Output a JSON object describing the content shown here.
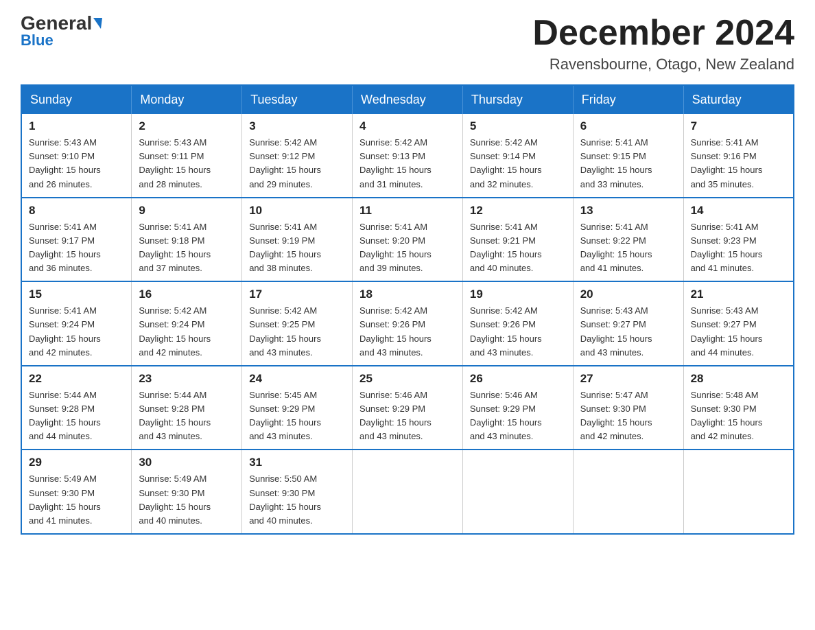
{
  "logo": {
    "name_part1": "General",
    "name_part2": "Blue"
  },
  "header": {
    "title": "December 2024",
    "location": "Ravensbourne, Otago, New Zealand"
  },
  "days_of_week": [
    "Sunday",
    "Monday",
    "Tuesday",
    "Wednesday",
    "Thursday",
    "Friday",
    "Saturday"
  ],
  "weeks": [
    [
      {
        "day": "1",
        "sunrise": "5:43 AM",
        "sunset": "9:10 PM",
        "daylight": "15 hours and 26 minutes."
      },
      {
        "day": "2",
        "sunrise": "5:43 AM",
        "sunset": "9:11 PM",
        "daylight": "15 hours and 28 minutes."
      },
      {
        "day": "3",
        "sunrise": "5:42 AM",
        "sunset": "9:12 PM",
        "daylight": "15 hours and 29 minutes."
      },
      {
        "day": "4",
        "sunrise": "5:42 AM",
        "sunset": "9:13 PM",
        "daylight": "15 hours and 31 minutes."
      },
      {
        "day": "5",
        "sunrise": "5:42 AM",
        "sunset": "9:14 PM",
        "daylight": "15 hours and 32 minutes."
      },
      {
        "day": "6",
        "sunrise": "5:41 AM",
        "sunset": "9:15 PM",
        "daylight": "15 hours and 33 minutes."
      },
      {
        "day": "7",
        "sunrise": "5:41 AM",
        "sunset": "9:16 PM",
        "daylight": "15 hours and 35 minutes."
      }
    ],
    [
      {
        "day": "8",
        "sunrise": "5:41 AM",
        "sunset": "9:17 PM",
        "daylight": "15 hours and 36 minutes."
      },
      {
        "day": "9",
        "sunrise": "5:41 AM",
        "sunset": "9:18 PM",
        "daylight": "15 hours and 37 minutes."
      },
      {
        "day": "10",
        "sunrise": "5:41 AM",
        "sunset": "9:19 PM",
        "daylight": "15 hours and 38 minutes."
      },
      {
        "day": "11",
        "sunrise": "5:41 AM",
        "sunset": "9:20 PM",
        "daylight": "15 hours and 39 minutes."
      },
      {
        "day": "12",
        "sunrise": "5:41 AM",
        "sunset": "9:21 PM",
        "daylight": "15 hours and 40 minutes."
      },
      {
        "day": "13",
        "sunrise": "5:41 AM",
        "sunset": "9:22 PM",
        "daylight": "15 hours and 41 minutes."
      },
      {
        "day": "14",
        "sunrise": "5:41 AM",
        "sunset": "9:23 PM",
        "daylight": "15 hours and 41 minutes."
      }
    ],
    [
      {
        "day": "15",
        "sunrise": "5:41 AM",
        "sunset": "9:24 PM",
        "daylight": "15 hours and 42 minutes."
      },
      {
        "day": "16",
        "sunrise": "5:42 AM",
        "sunset": "9:24 PM",
        "daylight": "15 hours and 42 minutes."
      },
      {
        "day": "17",
        "sunrise": "5:42 AM",
        "sunset": "9:25 PM",
        "daylight": "15 hours and 43 minutes."
      },
      {
        "day": "18",
        "sunrise": "5:42 AM",
        "sunset": "9:26 PM",
        "daylight": "15 hours and 43 minutes."
      },
      {
        "day": "19",
        "sunrise": "5:42 AM",
        "sunset": "9:26 PM",
        "daylight": "15 hours and 43 minutes."
      },
      {
        "day": "20",
        "sunrise": "5:43 AM",
        "sunset": "9:27 PM",
        "daylight": "15 hours and 43 minutes."
      },
      {
        "day": "21",
        "sunrise": "5:43 AM",
        "sunset": "9:27 PM",
        "daylight": "15 hours and 44 minutes."
      }
    ],
    [
      {
        "day": "22",
        "sunrise": "5:44 AM",
        "sunset": "9:28 PM",
        "daylight": "15 hours and 44 minutes."
      },
      {
        "day": "23",
        "sunrise": "5:44 AM",
        "sunset": "9:28 PM",
        "daylight": "15 hours and 43 minutes."
      },
      {
        "day": "24",
        "sunrise": "5:45 AM",
        "sunset": "9:29 PM",
        "daylight": "15 hours and 43 minutes."
      },
      {
        "day": "25",
        "sunrise": "5:46 AM",
        "sunset": "9:29 PM",
        "daylight": "15 hours and 43 minutes."
      },
      {
        "day": "26",
        "sunrise": "5:46 AM",
        "sunset": "9:29 PM",
        "daylight": "15 hours and 43 minutes."
      },
      {
        "day": "27",
        "sunrise": "5:47 AM",
        "sunset": "9:30 PM",
        "daylight": "15 hours and 42 minutes."
      },
      {
        "day": "28",
        "sunrise": "5:48 AM",
        "sunset": "9:30 PM",
        "daylight": "15 hours and 42 minutes."
      }
    ],
    [
      {
        "day": "29",
        "sunrise": "5:49 AM",
        "sunset": "9:30 PM",
        "daylight": "15 hours and 41 minutes."
      },
      {
        "day": "30",
        "sunrise": "5:49 AM",
        "sunset": "9:30 PM",
        "daylight": "15 hours and 40 minutes."
      },
      {
        "day": "31",
        "sunrise": "5:50 AM",
        "sunset": "9:30 PM",
        "daylight": "15 hours and 40 minutes."
      },
      null,
      null,
      null,
      null
    ]
  ]
}
